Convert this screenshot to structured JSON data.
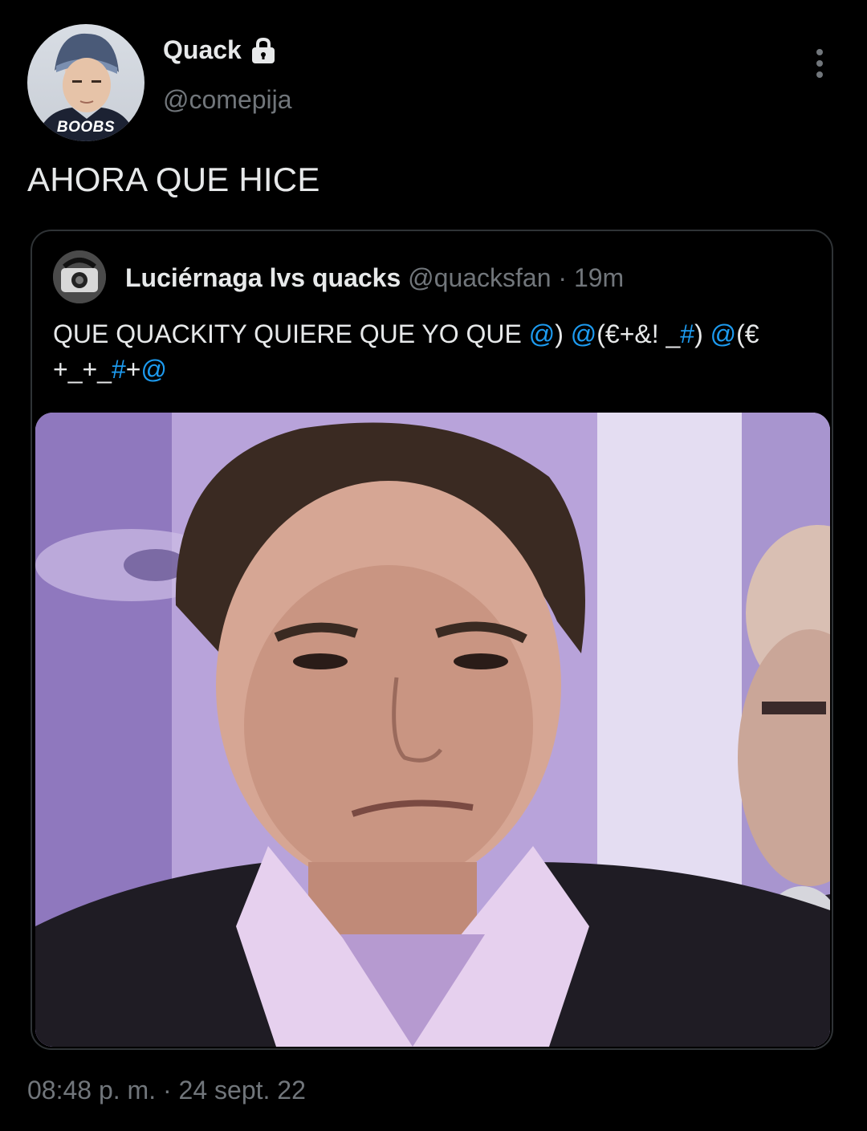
{
  "author": {
    "display_name": "Quack",
    "handle": "@comepija",
    "avatar_label": "BOOBS",
    "protected_icon": "lock-icon",
    "menu_icon": "more-vertical-icon"
  },
  "tweet": {
    "text": "AHORA QUE HICE",
    "timestamp": "08:48 p. m. · 24 sept. 22"
  },
  "quoted": {
    "display_name": "Luciérnaga lvs quacks",
    "handle": "@quacksfan",
    "separator": "·",
    "time": "19m",
    "text_parts": [
      {
        "t": "QUE QUACKITY QUIERE QUE YO QUE ",
        "mention": false
      },
      {
        "t": "@",
        "mention": true
      },
      {
        "t": ") ",
        "mention": false
      },
      {
        "t": "@",
        "mention": true
      },
      {
        "t": "(€+&! _",
        "mention": false
      },
      {
        "t": "#",
        "mention": true
      },
      {
        "t": ") ",
        "mention": false
      },
      {
        "t": "@",
        "mention": true
      },
      {
        "t": "(€ +_+_",
        "mention": false
      },
      {
        "t": "#",
        "mention": true
      },
      {
        "t": "+",
        "mention": false
      },
      {
        "t": "@",
        "mention": true
      }
    ]
  },
  "colors": {
    "background": "#000000",
    "text": "#e7e9ea",
    "secondary": "#71767b",
    "border": "#2f3336",
    "accent": "#1d9bf0"
  }
}
